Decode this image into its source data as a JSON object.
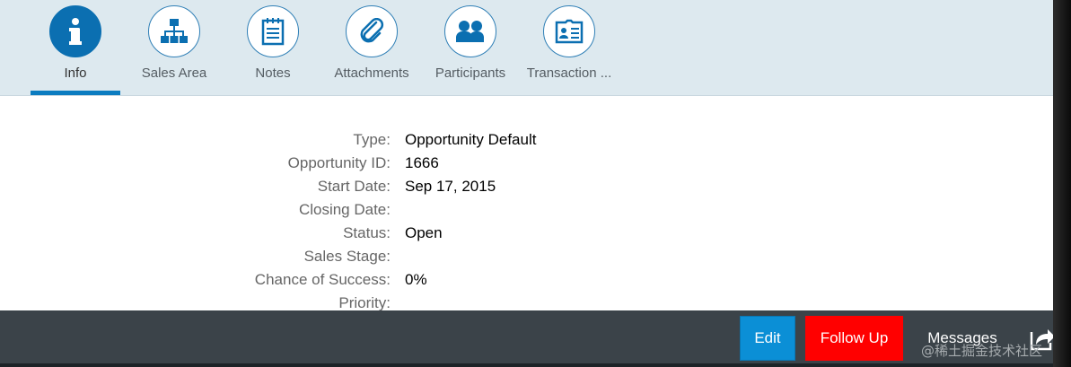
{
  "tabs": [
    {
      "label": "Info",
      "icon": "info-icon",
      "selected": true
    },
    {
      "label": "Sales Area",
      "icon": "org-chart-icon",
      "selected": false
    },
    {
      "label": "Notes",
      "icon": "notes-icon",
      "selected": false
    },
    {
      "label": "Attachments",
      "icon": "paperclip-icon",
      "selected": false
    },
    {
      "label": "Participants",
      "icon": "people-icon",
      "selected": false
    },
    {
      "label": "Transaction ...",
      "icon": "id-card-icon",
      "selected": false
    }
  ],
  "form": {
    "fields": [
      {
        "label": "Type:",
        "value": "Opportunity Default"
      },
      {
        "label": "Opportunity ID:",
        "value": "1666"
      },
      {
        "label": "Start Date:",
        "value": "Sep 17, 2015"
      },
      {
        "label": "Closing Date:",
        "value": ""
      },
      {
        "label": "Status:",
        "value": "Open"
      },
      {
        "label": "Sales Stage:",
        "value": ""
      },
      {
        "label": "Chance of Success:",
        "value": "0%"
      },
      {
        "label": "Priority:",
        "value": ""
      }
    ]
  },
  "footer": {
    "edit_label": "Edit",
    "follow_up_label": "Follow Up",
    "messages_label": "Messages",
    "share_icon": "share-icon"
  },
  "watermark": "@稀土掘金技术社区",
  "colors": {
    "accent": "#0b6fb1",
    "follow_up": "#ff0000",
    "edit": "#0b8fd6",
    "footer_bg": "#3b4349"
  }
}
